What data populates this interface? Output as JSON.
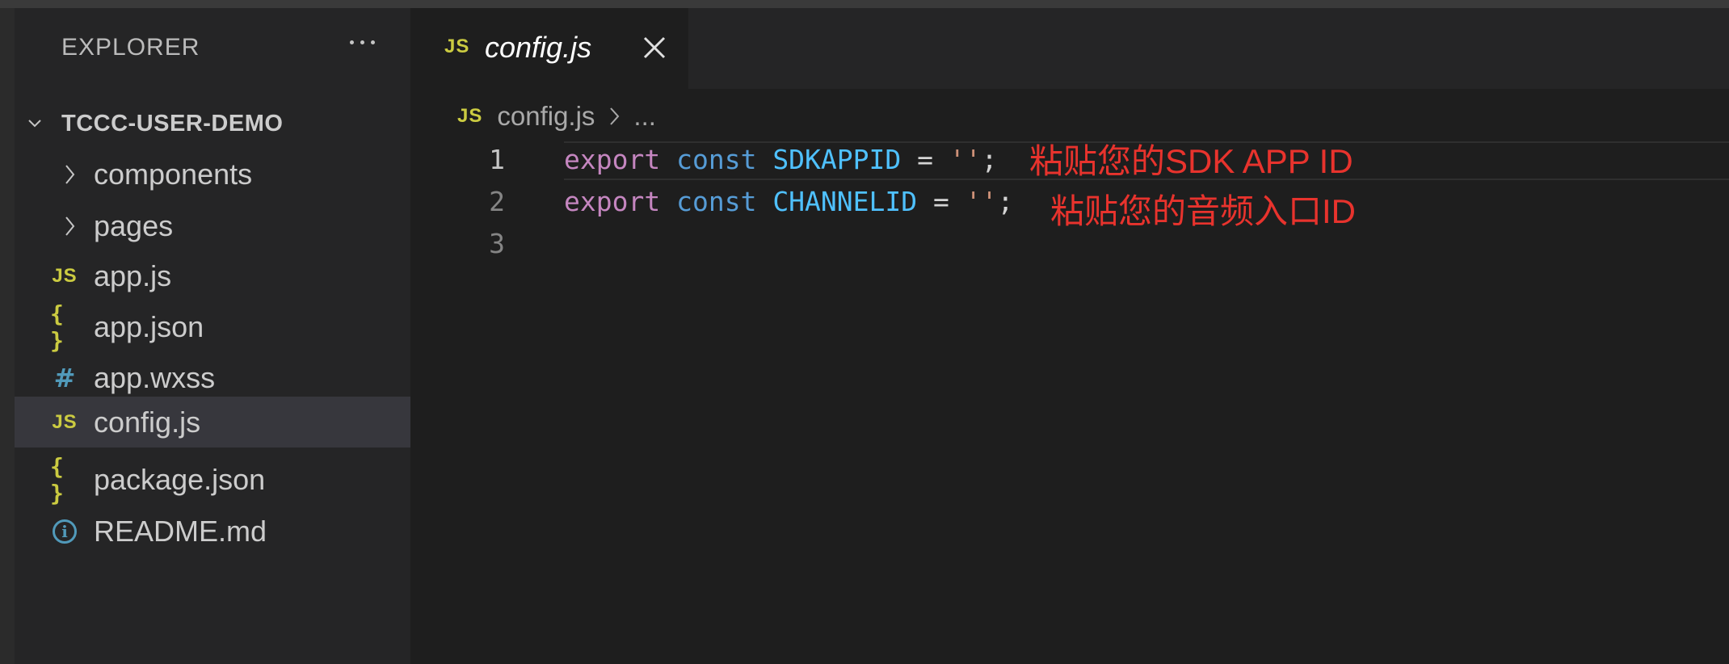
{
  "sidebar": {
    "title": "EXPLORER",
    "folder": "TCCC-USER-DEMO",
    "items": [
      {
        "label": "components",
        "type": "folder",
        "icon": "chevron-right-icon"
      },
      {
        "label": "pages",
        "type": "folder",
        "icon": "chevron-right-icon"
      },
      {
        "label": "app.js",
        "type": "file",
        "icon": "js-file-icon",
        "icon_text": "JS"
      },
      {
        "label": "app.json",
        "type": "file",
        "icon": "json-file-icon",
        "icon_text": "{ }"
      },
      {
        "label": "app.wxss",
        "type": "file",
        "icon": "css-file-icon",
        "icon_text": "#"
      },
      {
        "label": "config.js",
        "type": "file",
        "icon": "js-file-icon",
        "icon_text": "JS",
        "selected": true
      },
      {
        "label": "package.json",
        "type": "file",
        "icon": "json-file-icon",
        "icon_text": "{ }"
      },
      {
        "label": "README.md",
        "type": "file",
        "icon": "info-file-icon",
        "icon_text": "i"
      }
    ]
  },
  "tab": {
    "icon_text": "JS",
    "label": "config.js"
  },
  "breadcrumb": {
    "icon_text": "JS",
    "file": "config.js",
    "ellipsis": "..."
  },
  "editor": {
    "lines": [
      {
        "num": "1",
        "keyword1": "export",
        "keyword2": "const",
        "name": "SDKAPPID",
        "op": "=",
        "value": "''",
        "end": ";"
      },
      {
        "num": "2",
        "keyword1": "export",
        "keyword2": "const",
        "name": "CHANNELID",
        "op": "=",
        "value": "''",
        "end": ";"
      },
      {
        "num": "3"
      }
    ],
    "annotations": [
      "粘贴您的SDK APP ID",
      "粘贴您的音频入口ID"
    ]
  },
  "colors": {
    "background": "#1e1e1e",
    "sidebar": "#252526",
    "selected_row": "#37373d",
    "js_icon": "#cbcb41",
    "keyword_export": "#c586c0",
    "keyword_const": "#569cd6",
    "identifier": "#4fc1ff",
    "string": "#ce9178",
    "annotation": "#e8332d"
  }
}
